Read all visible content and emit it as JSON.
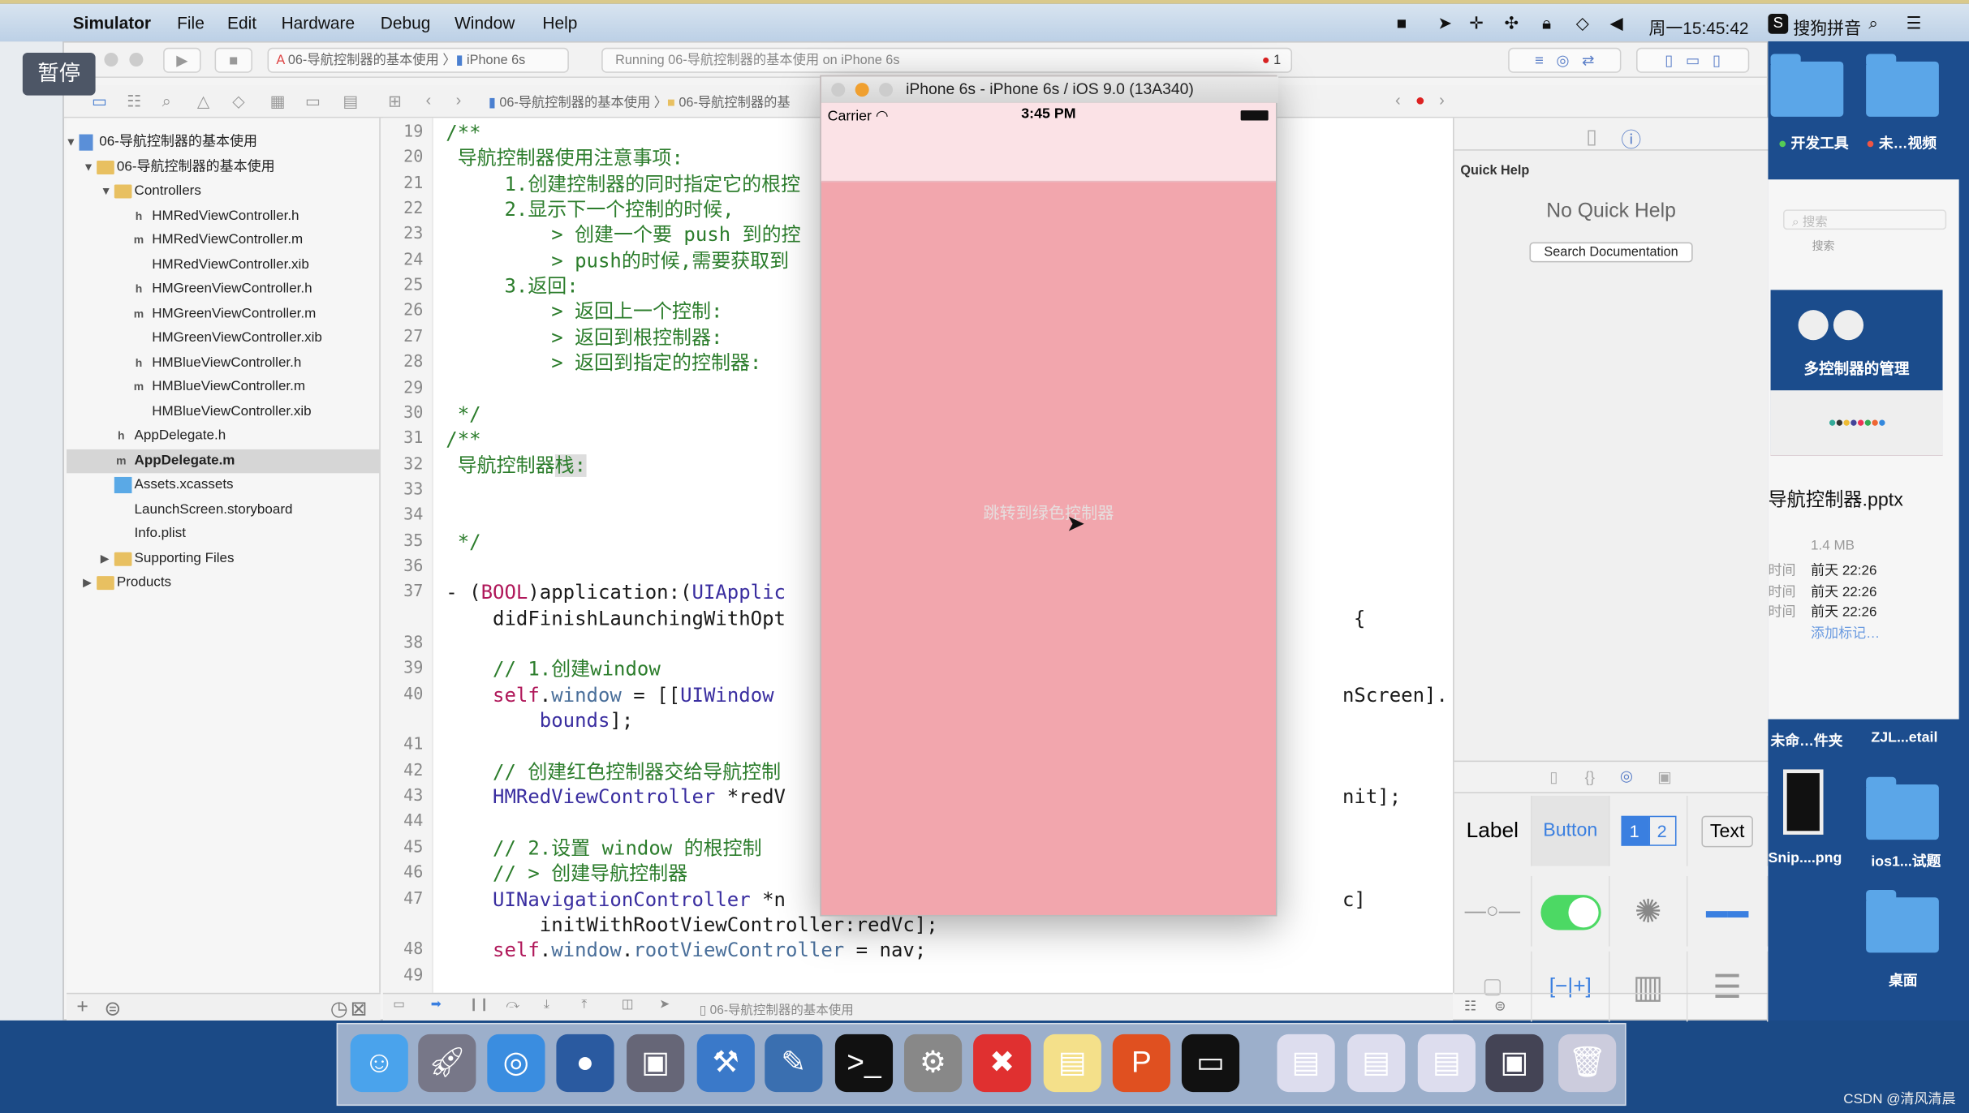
{
  "menubar": {
    "app": "Simulator",
    "items": [
      "File",
      "Edit",
      "Hardware",
      "Debug",
      "Window",
      "Help"
    ],
    "clock": "周一15:45:42",
    "ime": "搜狗拼音"
  },
  "overlay": {
    "pause": "暂停"
  },
  "toolbar": {
    "scheme": "06-导航控制器的基本使用",
    "device": "iPhone 6s",
    "status": "Running 06-导航控制器的基本使用 on iPhone 6s",
    "error_count": "1"
  },
  "jumpbar": {
    "project": "06-导航控制器的基本使用",
    "group": "06-导航控制器的基",
    "error_count": ""
  },
  "navigator": {
    "items": [
      {
        "label": "06-导航控制器的基本使用",
        "type": "proj",
        "level": 0,
        "disc": "▼"
      },
      {
        "label": "06-导航控制器的基本使用",
        "type": "folder",
        "level": 1,
        "disc": "▼"
      },
      {
        "label": "Controllers",
        "type": "folder",
        "level": 2,
        "disc": "▼"
      },
      {
        "label": "HMRedViewController.h",
        "type": "h",
        "level": 3
      },
      {
        "label": "HMRedViewController.m",
        "type": "m",
        "level": 3
      },
      {
        "label": "HMRedViewController.xib",
        "type": "xib",
        "level": 3
      },
      {
        "label": "HMGreenViewController.h",
        "type": "h",
        "level": 3
      },
      {
        "label": "HMGreenViewController.m",
        "type": "m",
        "level": 3
      },
      {
        "label": "HMGreenViewController.xib",
        "type": "xib",
        "level": 3
      },
      {
        "label": "HMBlueViewController.h",
        "type": "h",
        "level": 3
      },
      {
        "label": "HMBlueViewController.m",
        "type": "m",
        "level": 3
      },
      {
        "label": "HMBlueViewController.xib",
        "type": "xib",
        "level": 3
      },
      {
        "label": "AppDelegate.h",
        "type": "h",
        "level": 2
      },
      {
        "label": "AppDelegate.m",
        "type": "m",
        "level": 2,
        "selected": true
      },
      {
        "label": "Assets.xcassets",
        "type": "assets",
        "level": 2
      },
      {
        "label": "LaunchScreen.storyboard",
        "type": "xib",
        "level": 2
      },
      {
        "label": "Info.plist",
        "type": "plist",
        "level": 2
      },
      {
        "label": "Supporting Files",
        "type": "folder",
        "level": 2,
        "disc": "▶"
      },
      {
        "label": "Products",
        "type": "folder",
        "level": 1,
        "disc": "▶"
      }
    ]
  },
  "code": {
    "lines": [
      {
        "n": "19",
        "segs": [
          [
            "/**",
            "com"
          ]
        ]
      },
      {
        "n": "20",
        "segs": [
          [
            " 导航控制器使用注意事项:",
            "com"
          ]
        ]
      },
      {
        "n": "21",
        "segs": [
          [
            "     1.创建控制器的同时指定它的根控",
            "com"
          ]
        ]
      },
      {
        "n": "22",
        "segs": [
          [
            "     2.显示下一个控制的时候,",
            "com"
          ]
        ]
      },
      {
        "n": "23",
        "segs": [
          [
            "         > 创建一个要 push 到的控",
            "com"
          ]
        ]
      },
      {
        "n": "24",
        "segs": [
          [
            "         > push的时候,需要获取到",
            "com"
          ]
        ]
      },
      {
        "n": "25",
        "segs": [
          [
            "     3.返回:",
            "com"
          ]
        ]
      },
      {
        "n": "26",
        "segs": [
          [
            "         > 返回上一个控制:",
            "com"
          ]
        ]
      },
      {
        "n": "27",
        "segs": [
          [
            "         > 返回到根控制器:",
            "com"
          ]
        ]
      },
      {
        "n": "28",
        "segs": [
          [
            "         > 返回到指定的控制器:",
            "com"
          ]
        ]
      },
      {
        "n": "29",
        "segs": []
      },
      {
        "n": "30",
        "segs": [
          [
            " */",
            "com"
          ]
        ]
      },
      {
        "n": "31",
        "segs": [
          [
            "/**",
            "com"
          ]
        ]
      },
      {
        "n": "32",
        "segs": [
          [
            " 导航控制器",
            "com"
          ],
          [
            "栈:",
            "com hl"
          ]
        ]
      },
      {
        "n": "33",
        "segs": []
      },
      {
        "n": "34",
        "segs": []
      },
      {
        "n": "35",
        "segs": [
          [
            " */",
            "com"
          ]
        ]
      },
      {
        "n": "36",
        "segs": []
      },
      {
        "n": "37",
        "segs": [
          [
            "- (",
            "plain"
          ],
          [
            "BOOL",
            "kw"
          ],
          [
            ")application:(",
            "plain"
          ],
          [
            "UIApplic",
            "cls"
          ]
        ]
      },
      {
        "n": "",
        "segs": [
          [
            "    didFinishLaunchingWithOpt",
            "plain"
          ]
        ],
        "right": "{"
      },
      {
        "n": "38",
        "segs": []
      },
      {
        "n": "39",
        "segs": [
          [
            "    // 1.创建window",
            "com"
          ]
        ]
      },
      {
        "n": "40",
        "segs": [
          [
            "    ",
            "plain"
          ],
          [
            "self",
            "kw"
          ],
          [
            ".",
            "plain"
          ],
          [
            "window",
            "prop"
          ],
          [
            " = [[",
            "plain"
          ],
          [
            "UIWindow",
            "cls"
          ]
        ],
        "right": "nScreen]."
      },
      {
        "n": "",
        "segs": [
          [
            "        ",
            "plain"
          ],
          [
            "bounds",
            "cls"
          ],
          [
            "];",
            "plain"
          ]
        ]
      },
      {
        "n": "41",
        "segs": []
      },
      {
        "n": "42",
        "segs": [
          [
            "    // 创建红色控制器交给导航控制",
            "com"
          ]
        ]
      },
      {
        "n": "43",
        "segs": [
          [
            "    ",
            "plain"
          ],
          [
            "HMRedViewController",
            "cls"
          ],
          [
            " *redV",
            "plain"
          ]
        ],
        "right": "nit];"
      },
      {
        "n": "44",
        "segs": []
      },
      {
        "n": "45",
        "segs": [
          [
            "    // 2.设置 window 的根控制",
            "com"
          ]
        ]
      },
      {
        "n": "46",
        "segs": [
          [
            "    // > 创建导航控制器",
            "com"
          ]
        ]
      },
      {
        "n": "47",
        "segs": [
          [
            "    ",
            "plain"
          ],
          [
            "UINavigationController",
            "cls"
          ],
          [
            " *n",
            "plain"
          ]
        ],
        "right": "c]"
      },
      {
        "n": "",
        "segs": [
          [
            "        initWithRootViewController:redVc];",
            "plain"
          ]
        ]
      },
      {
        "n": "48",
        "segs": [
          [
            "    ",
            "plain"
          ],
          [
            "self",
            "kw"
          ],
          [
            ".",
            "plain"
          ],
          [
            "window",
            "prop"
          ],
          [
            ".",
            "plain"
          ],
          [
            "rootViewController",
            "prop"
          ],
          [
            " = nav;",
            "plain"
          ]
        ]
      },
      {
        "n": "49",
        "segs": []
      }
    ]
  },
  "debugbar": {
    "target": "06-导航控制器的基本使用"
  },
  "simulator": {
    "title": "iPhone 6s - iPhone 6s / iOS 9.0 (13A340)",
    "carrier": "Carrier",
    "time": "3:45 PM",
    "button": "跳转到绿色控制器",
    "bg": "#f2a6ad"
  },
  "quickhelp": {
    "title": "Quick Help",
    "empty": "No Quick Help",
    "search": "Search Documentation"
  },
  "library": {
    "label": "Label",
    "button": "Button",
    "seg1": "1",
    "seg2": "2",
    "text": "Text"
  },
  "desktop": {
    "labels": [
      "开发工具",
      "未…视频",
      "未命…件夹",
      "ZJL...etail",
      "Snip....png",
      "ios1...试题",
      "桌面"
    ],
    "preview": {
      "slide_title": "多控制器的管理",
      "file": "导航控制器.pptx",
      "size": "1.4 MB",
      "rows": [
        [
          "时间",
          "前天 22:26"
        ],
        [
          "时间",
          "前天 22:26"
        ],
        [
          "时间",
          "前天 22:26"
        ]
      ],
      "tag": "添加标记…",
      "search": "搜索",
      "search_label": "搜索"
    }
  },
  "dock": {
    "apps": [
      "finder",
      "launchpad",
      "safari",
      "mouse",
      "photo-slideshow",
      "xcode",
      "instruments",
      "terminal",
      "system-preferences",
      "xmind",
      "notes",
      "wps",
      "activity-monitor",
      "documents-1",
      "documents-2",
      "documents-3",
      "screen-capture",
      "trash"
    ]
  },
  "watermark": "CSDN @清风清晨"
}
